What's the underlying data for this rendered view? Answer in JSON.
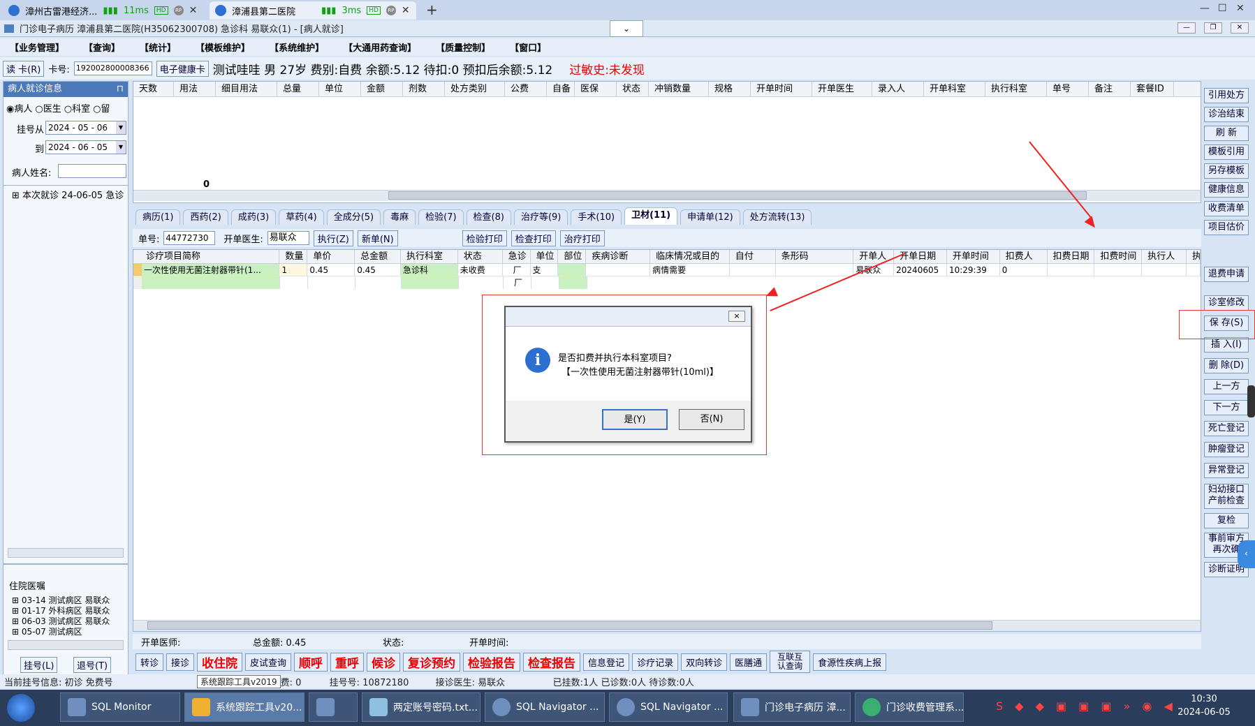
{
  "browser_tabs": [
    {
      "title": "漳州古雷港经济...",
      "signal": "11ms",
      "hd": "HD",
      "rp": "RP"
    },
    {
      "title": "漳浦县第二医院",
      "signal": "3ms",
      "hd": "HD",
      "rp": "RP"
    }
  ],
  "browser_new_tab": "+",
  "app_title": "门诊电子病历  漳浦县第二医院(H35062300708)  急诊科  易联众(1) - [病人就诊]",
  "menu": [
    "【业务管理】",
    "【查询】",
    "【统计】",
    "【模板维护】",
    "【系统维护】",
    "【大通用药查询】",
    "【质量控制】",
    "【窗口】"
  ],
  "patient_strip": {
    "read_card": "读 卡(R)",
    "card_label": "卡号:",
    "card_no": "192002800008366",
    "ehealth": "电子健康卡",
    "info": "测试哇哇  男  27岁  费别:自费  余额:5.12  待扣:0  预扣后余额:5.12",
    "allergy": "过敏史:未发现"
  },
  "left": {
    "header": "病人就诊信息",
    "radios": [
      "病人",
      "医生",
      "科室",
      "留"
    ],
    "reg_from_label": "挂号从",
    "reg_from": "2024 - 05 - 06",
    "reg_to_label": "到",
    "reg_to": "2024 - 06 - 05",
    "name_label": "病人姓名:",
    "tree_item": "本次就诊 24-06-05 急诊",
    "inpatient_header": "住院医嘱",
    "inpatient_items": [
      "03-14 测试病区 易联众",
      "01-17 外科病区 易联众",
      "06-03 测试病区 易联众",
      "05-07 测试病区"
    ],
    "btn_reg": "挂号(L)",
    "btn_unreg": "退号(T)"
  },
  "top_grid": {
    "headers": [
      "天数",
      "用法",
      "细目用法",
      "总量",
      "单位",
      "金额",
      "剂数",
      "处方类别",
      "公费",
      "自备",
      "医保",
      "状态",
      "冲销数量",
      "规格",
      "开单时间",
      "开单医生",
      "录入人",
      "开单科室",
      "执行科室",
      "单号",
      "备注",
      "套餐ID"
    ],
    "count": "0"
  },
  "tabs": [
    "病历(1)",
    "西药(2)",
    "成药(3)",
    "草药(4)",
    "全成分(5)",
    "毒麻",
    "检验(7)",
    "检查(8)",
    "治疗等(9)",
    "手术(10)",
    "卫材(11)",
    "申请单(12)",
    "处方流转(13)"
  ],
  "active_tab": "卫材(11)",
  "action_row": {
    "order_label": "单号:",
    "order_no": "44772730",
    "doctor_label": "开单医生:",
    "doctor": "易联众",
    "exec": "执行(Z)",
    "new": "新单(N)",
    "print1": "检验打印",
    "print2": "检查打印",
    "print3": "治疗打印"
  },
  "low_grid": {
    "headers": [
      "诊疗项目简称",
      "数量",
      "单价",
      "总金额",
      "执行科室",
      "状态",
      "急诊",
      "单位",
      "部位",
      "疾病诊断",
      "临床情况或目的",
      "自付",
      "条形码",
      "开单人",
      "开单日期",
      "开单时间",
      "扣费人",
      "扣费日期",
      "扣费时间",
      "执行人",
      "执"
    ],
    "row": [
      "一次性使用无菌注射器带针(1...",
      "1",
      "0.45",
      "0.45",
      "急诊科",
      "未收费",
      "厂",
      "支",
      "",
      "",
      "病情需要",
      "",
      "",
      "易联众",
      "20240605",
      "10:29:39",
      "0",
      "",
      "",
      "",
      ""
    ],
    "row2_check": "厂"
  },
  "right_buttons": [
    "引用处方",
    "诊治结束",
    "刷 新",
    "模板引用",
    "另存模板",
    "健康信息",
    "收费清单",
    "项目估价",
    "退费申请",
    "诊室修改",
    "保 存(S)",
    "插 入(I)",
    "删 除(D)",
    "上一方",
    "下一方",
    "死亡登记",
    "肿瘤登记",
    "异常登记",
    "妇幼接口产前检查",
    "复检",
    "事前审方再次确",
    "诊断证明"
  ],
  "dialog": {
    "line1": "是否扣费并执行本科室项目?",
    "line2": "【一次性使用无菌注射器带针(10ml)】",
    "yes": "是(Y)",
    "no": "否(N)",
    "close": "×"
  },
  "status_row": {
    "doctor_label": "开单医师:",
    "total_label": "总金额: 0.45",
    "state_label": "状态:",
    "time_label": "开单时间:"
  },
  "bottom_buttons": [
    {
      "label": "转诊",
      "red": false
    },
    {
      "label": "接诊",
      "red": false
    },
    {
      "label": "收住院",
      "red": true
    },
    {
      "label": "皮试查询",
      "red": false
    },
    {
      "label": "顺呼",
      "red": true
    },
    {
      "label": "重呼",
      "red": true
    },
    {
      "label": "候诊",
      "red": true
    },
    {
      "label": "复诊预约",
      "red": true
    },
    {
      "label": "检验报告",
      "red": true
    },
    {
      "label": "检查报告",
      "red": true
    },
    {
      "label": "信息登记",
      "red": false
    },
    {
      "label": "诊疗记录",
      "red": false
    },
    {
      "label": "双向转诊",
      "red": false
    },
    {
      "label": "医膳通",
      "red": false
    },
    {
      "label": "互联互认查询",
      "red": false
    },
    {
      "label": "食源性疾病上报",
      "red": false
    }
  ],
  "info_bar": {
    "text1": "当前挂号信息:  初诊 免费号",
    "tooltip": "系统跟踪工具v2019",
    "fee": "费: 0",
    "reg_no": "挂号号:  10872180",
    "doctor": "接诊医生:  易联众",
    "counts": "已挂数:1人  已诊数:0人  待诊数:0人"
  },
  "taskbar": {
    "items": [
      "SQL Monitor",
      "系统跟踪工具v20...",
      "",
      "两定账号密码.txt...",
      "SQL Navigator ...",
      "SQL Navigator ...",
      "门诊电子病历  漳...",
      "门诊收费管理系..."
    ],
    "time": "10:30",
    "date": "2024-06-05"
  }
}
